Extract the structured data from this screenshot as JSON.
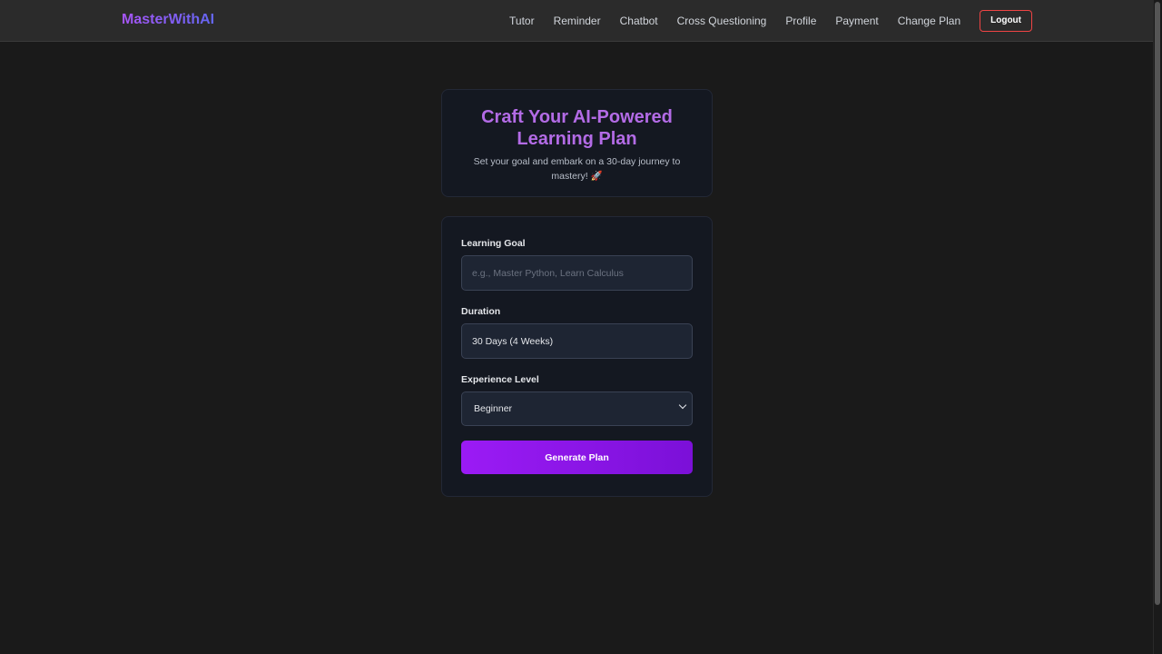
{
  "nav": {
    "brand": "MasterWithAI",
    "links": [
      "Tutor",
      "Reminder",
      "Chatbot",
      "Cross Questioning",
      "Profile",
      "Payment",
      "Change Plan"
    ],
    "logout_label": "Logout"
  },
  "hero": {
    "title": "Craft Your AI-Powered Learning Plan",
    "subtitle": "Set your goal and embark on a 30-day journey to mastery! 🚀"
  },
  "form": {
    "goal_label": "Learning Goal",
    "goal_placeholder": "e.g., Master Python, Learn Calculus",
    "goal_value": "",
    "duration_label": "Duration",
    "duration_value": "30 Days (4 Weeks)",
    "level_label": "Experience Level",
    "level_value": "Beginner",
    "submit_label": "Generate Plan"
  },
  "colors": {
    "accent": "#9b1bf5",
    "title": "#b36be6",
    "logout_border": "#ef4444"
  }
}
